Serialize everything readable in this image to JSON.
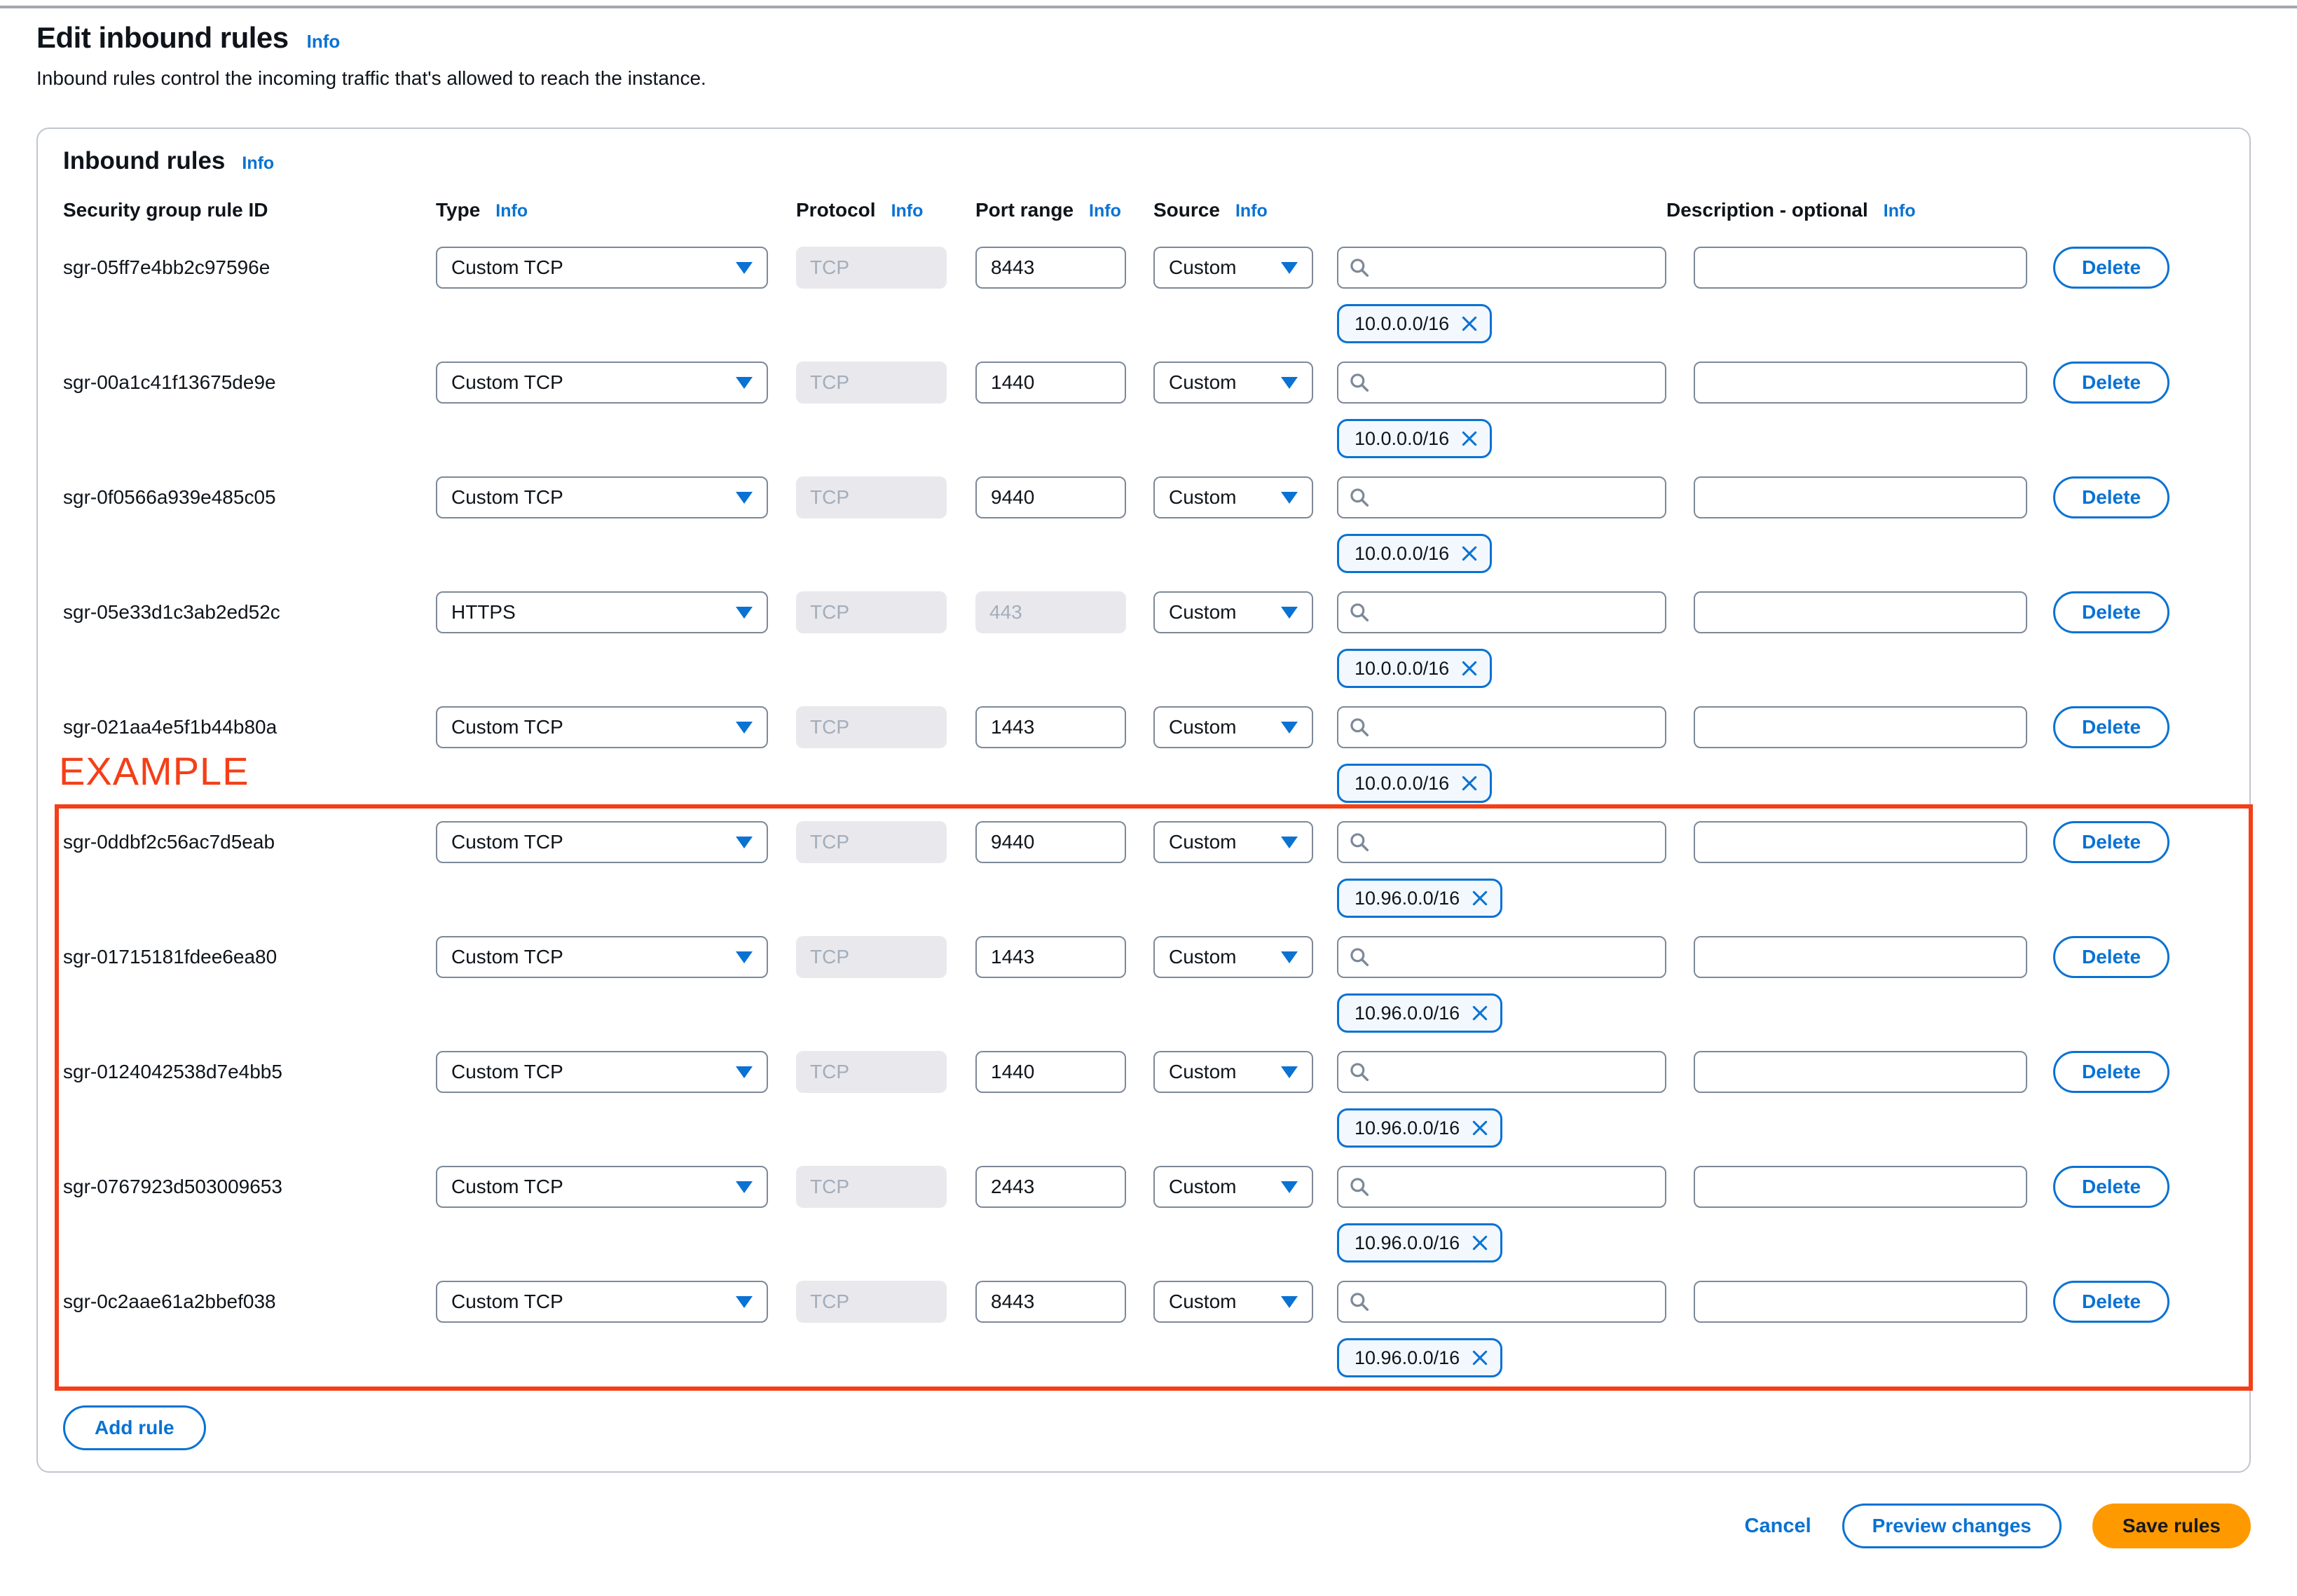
{
  "page": {
    "title": "Edit inbound rules",
    "title_info": "Info",
    "subtitle": "Inbound rules control the incoming traffic that's allowed to reach the instance."
  },
  "panel": {
    "heading": "Inbound rules",
    "heading_info": "Info",
    "columns": {
      "id": "Security group rule ID",
      "type": "Type",
      "protocol": "Protocol",
      "port": "Port range",
      "source": "Source",
      "description": "Description - optional",
      "info": "Info"
    },
    "delete_label": "Delete",
    "add_rule_label": "Add rule",
    "rows": [
      {
        "id": "sgr-05ff7e4bb2c97596e",
        "type": "Custom TCP",
        "protocol": "TCP",
        "port": "8443",
        "port_disabled": false,
        "source": "Custom",
        "cidr": "10.0.0.0/16"
      },
      {
        "id": "sgr-00a1c41f13675de9e",
        "type": "Custom TCP",
        "protocol": "TCP",
        "port": "1440",
        "port_disabled": false,
        "source": "Custom",
        "cidr": "10.0.0.0/16"
      },
      {
        "id": "sgr-0f0566a939e485c05",
        "type": "Custom TCP",
        "protocol": "TCP",
        "port": "9440",
        "port_disabled": false,
        "source": "Custom",
        "cidr": "10.0.0.0/16"
      },
      {
        "id": "sgr-05e33d1c3ab2ed52c",
        "type": "HTTPS",
        "protocol": "TCP",
        "port": "443",
        "port_disabled": true,
        "source": "Custom",
        "cidr": "10.0.0.0/16"
      },
      {
        "id": "sgr-021aa4e5f1b44b80a",
        "type": "Custom TCP",
        "protocol": "TCP",
        "port": "1443",
        "port_disabled": false,
        "source": "Custom",
        "cidr": "10.0.0.0/16"
      },
      {
        "id": "sgr-0ddbf2c56ac7d5eab",
        "type": "Custom TCP",
        "protocol": "TCP",
        "port": "9440",
        "port_disabled": false,
        "source": "Custom",
        "cidr": "10.96.0.0/16"
      },
      {
        "id": "sgr-01715181fdee6ea80",
        "type": "Custom TCP",
        "protocol": "TCP",
        "port": "1443",
        "port_disabled": false,
        "source": "Custom",
        "cidr": "10.96.0.0/16"
      },
      {
        "id": "sgr-0124042538d7e4bb5",
        "type": "Custom TCP",
        "protocol": "TCP",
        "port": "1440",
        "port_disabled": false,
        "source": "Custom",
        "cidr": "10.96.0.0/16"
      },
      {
        "id": "sgr-0767923d503009653",
        "type": "Custom TCP",
        "protocol": "TCP",
        "port": "2443",
        "port_disabled": false,
        "source": "Custom",
        "cidr": "10.96.0.0/16"
      },
      {
        "id": "sgr-0c2aae61a2bbef038",
        "type": "Custom TCP",
        "protocol": "TCP",
        "port": "8443",
        "port_disabled": false,
        "source": "Custom",
        "cidr": "10.96.0.0/16"
      }
    ]
  },
  "annotation": {
    "label": "EXAMPLE",
    "color": "#f43f17"
  },
  "footer": {
    "cancel_label": "Cancel",
    "preview_label": "Preview changes",
    "save_label": "Save rules"
  },
  "colors": {
    "accent_blue": "#0972d3",
    "save_orange": "#ff9900",
    "input_border": "#7d8998",
    "disabled_bg": "#e9e9ed",
    "chip_bg": "#f2f8fd",
    "text": "#0f141a"
  }
}
